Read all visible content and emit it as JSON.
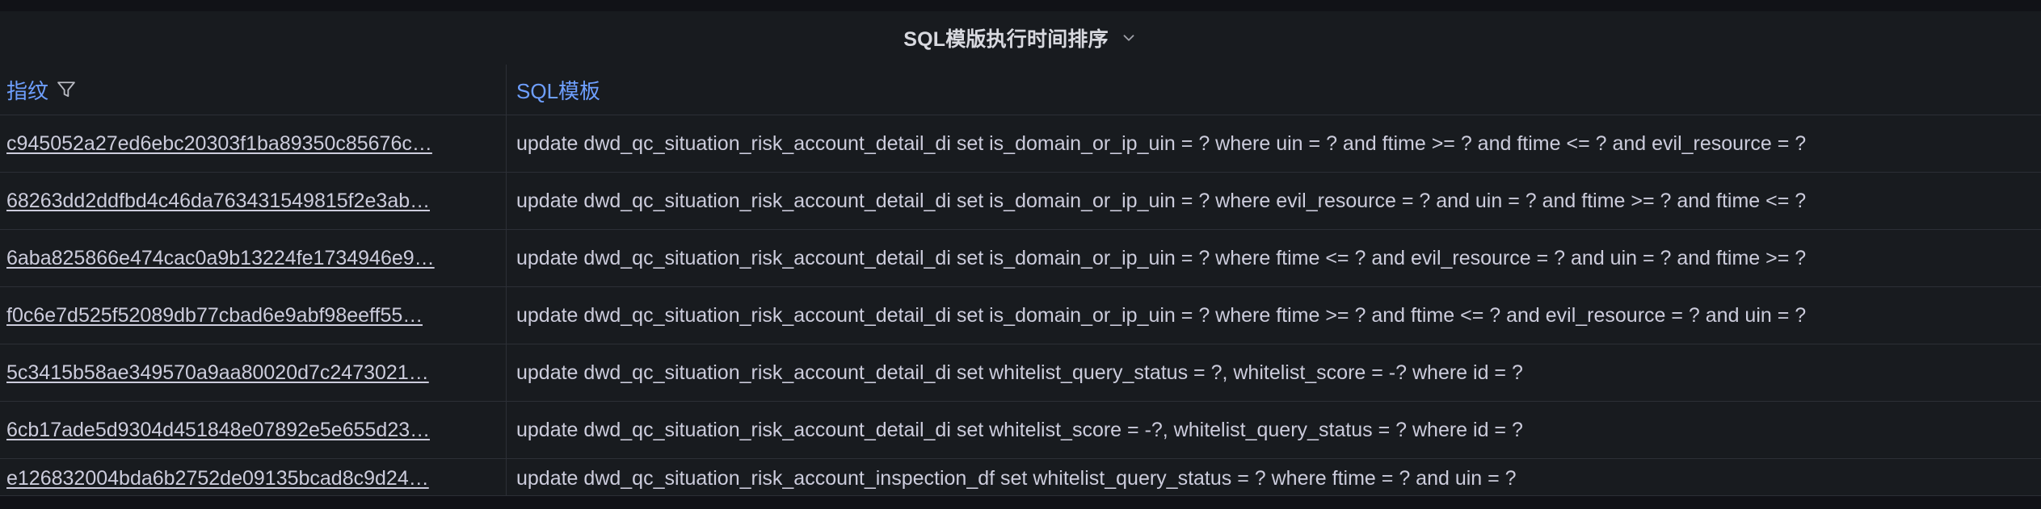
{
  "panel": {
    "title": "SQL模版执行时间排序"
  },
  "table": {
    "columns": [
      {
        "label": "指纹"
      },
      {
        "label": "SQL模板"
      }
    ],
    "rows": [
      {
        "fingerprint": "c945052a27ed6ebc20303f1ba89350c85676c…",
        "sql": "update dwd_qc_situation_risk_account_detail_di set is_domain_or_ip_uin = ? where uin = ? and ftime >= ? and ftime <= ? and evil_resource = ?"
      },
      {
        "fingerprint": "68263dd2ddfbd4c46da763431549815f2e3ab…",
        "sql": "update dwd_qc_situation_risk_account_detail_di set is_domain_or_ip_uin = ? where evil_resource = ? and uin = ? and ftime >= ? and ftime <= ?"
      },
      {
        "fingerprint": "6aba825866e474cac0a9b13224fe1734946e9…",
        "sql": "update dwd_qc_situation_risk_account_detail_di set is_domain_or_ip_uin = ? where ftime <= ? and evil_resource = ? and uin = ? and ftime >= ?"
      },
      {
        "fingerprint": "f0c6e7d525f52089db77cbad6e9abf98eeff55…",
        "sql": "update dwd_qc_situation_risk_account_detail_di set is_domain_or_ip_uin = ? where ftime >= ? and ftime <= ? and evil_resource = ? and uin = ?"
      },
      {
        "fingerprint": "5c3415b58ae349570a9aa80020d7c2473021…",
        "sql": "update dwd_qc_situation_risk_account_detail_di set whitelist_query_status = ?, whitelist_score = -? where id = ?"
      },
      {
        "fingerprint": "6cb17ade5d9304d451848e07892e5e655d23…",
        "sql": "update dwd_qc_situation_risk_account_detail_di set whitelist_score = -?, whitelist_query_status = ? where id = ?"
      },
      {
        "fingerprint": "e126832004bda6b2752de09135bcad8c9d24…",
        "sql": "update dwd_qc_situation_risk_account_inspection_df set whitelist_query_status = ? where ftime = ? and uin = ?"
      }
    ]
  },
  "icons": {
    "title_menu": "chevron-down-icon",
    "column_filter": "filter-icon"
  },
  "colors": {
    "background": "#111217",
    "panel": "#181b1f",
    "header_link": "#6e9fff",
    "text": "#ccccdc",
    "border": "#2c2f36"
  }
}
